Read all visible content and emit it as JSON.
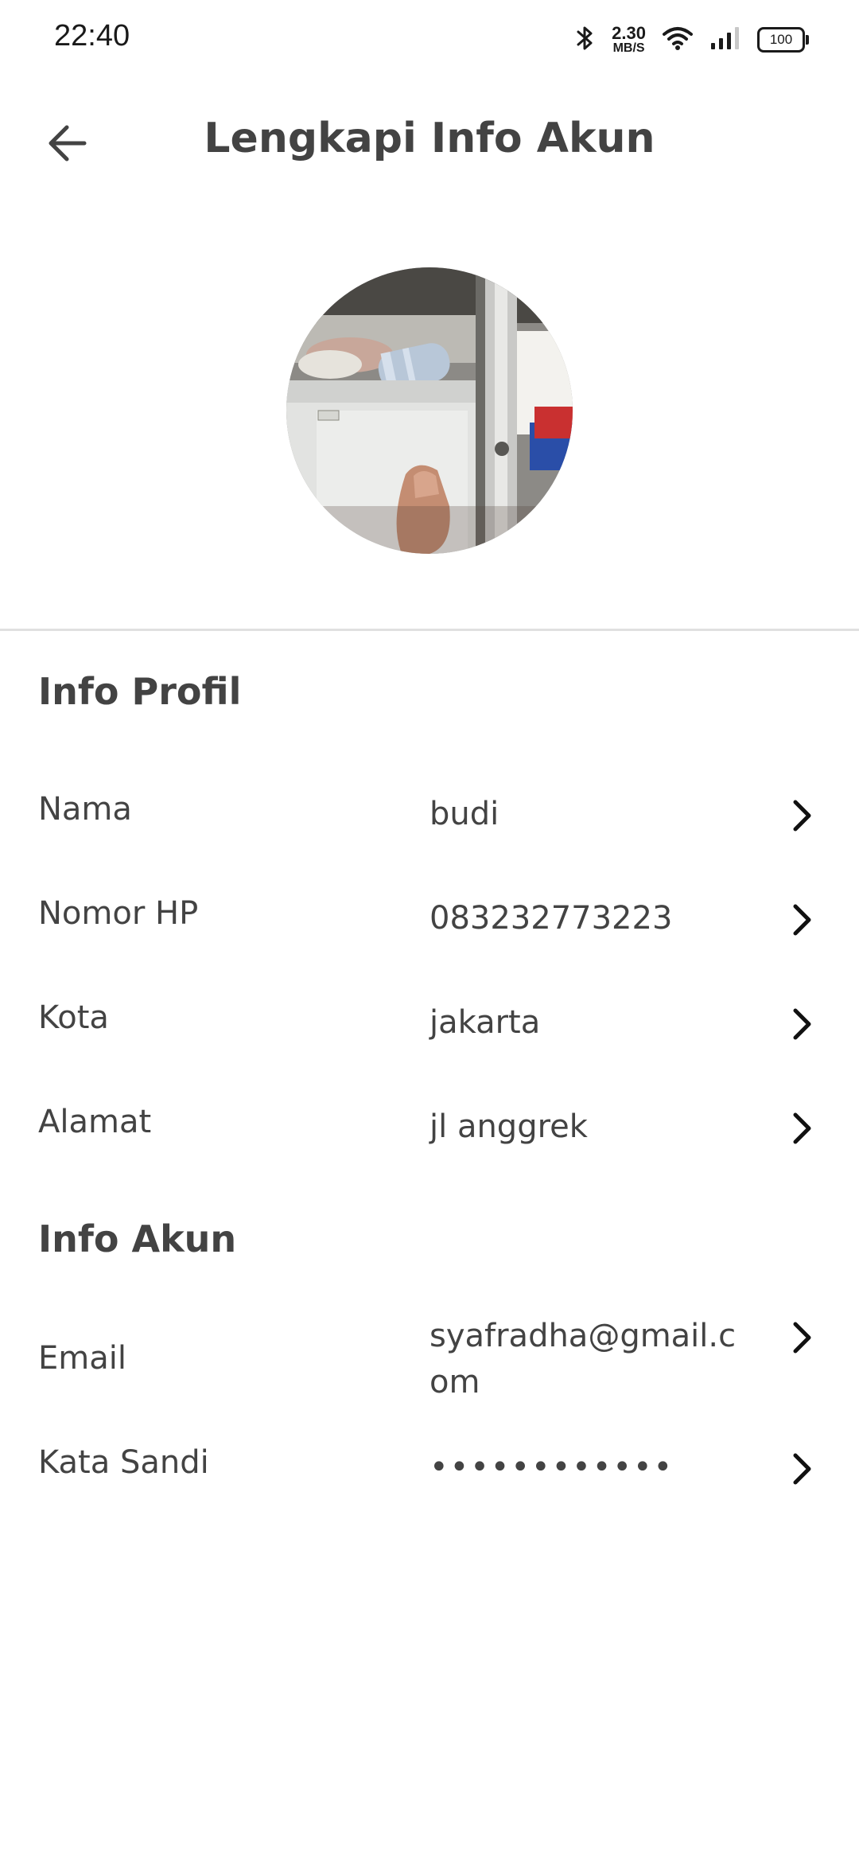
{
  "status_bar": {
    "time": "22:40",
    "net_speed_value": "2.30",
    "net_speed_unit": "MB/S",
    "battery": "100",
    "icons": [
      "bluetooth-icon",
      "wifi-icon",
      "signal-icon",
      "battery-icon"
    ]
  },
  "header": {
    "title": "Lengkapi Info Akun",
    "back_icon": "arrow-left-icon"
  },
  "profile_section": {
    "title": "Info Profil",
    "rows": [
      {
        "label": "Nama",
        "value": "budi"
      },
      {
        "label": "Nomor HP",
        "value": "083232773223"
      },
      {
        "label": "Kota",
        "value": "jakarta"
      },
      {
        "label": "Alamat",
        "value": "jl anggrek"
      }
    ]
  },
  "account_section": {
    "title": "Info Akun",
    "rows": [
      {
        "label": "Email",
        "value": "syafradha@gmail.com"
      },
      {
        "label": "Kata Sandi",
        "value": "••••••••••••"
      }
    ]
  },
  "colors": {
    "text": "#434343",
    "divider": "#e0e0e0",
    "background": "#ffffff"
  }
}
